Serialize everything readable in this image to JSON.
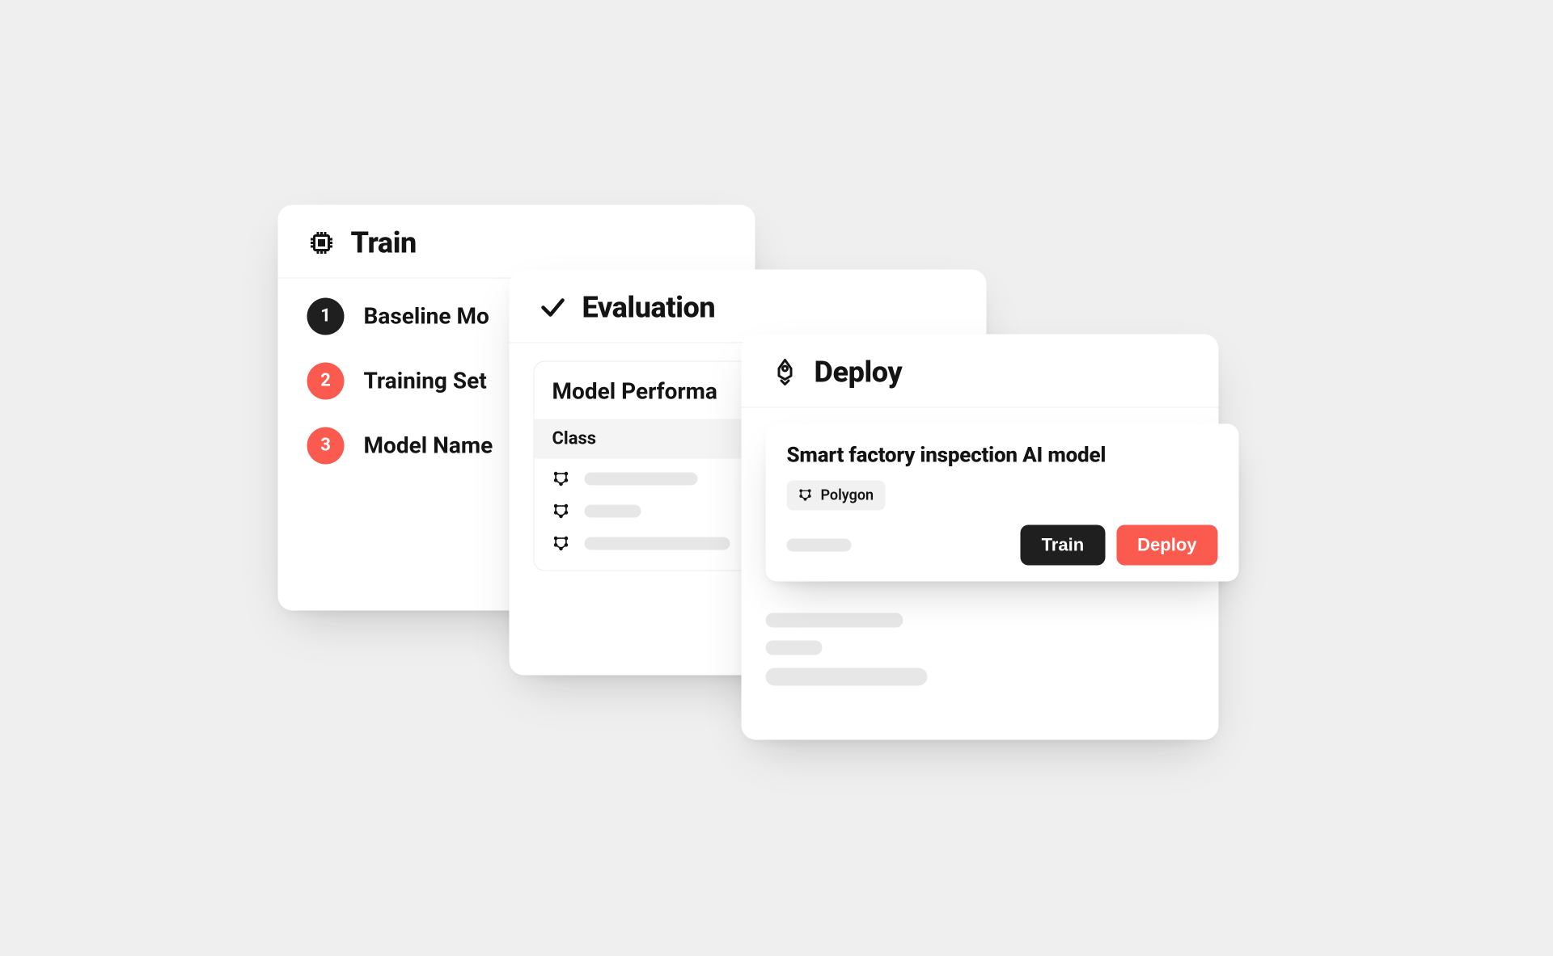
{
  "train": {
    "title": "Train",
    "steps": [
      {
        "num": "1",
        "label": "Baseline Mo",
        "variant": "dark"
      },
      {
        "num": "2",
        "label": "Training Set",
        "variant": "accent"
      },
      {
        "num": "3",
        "label": "Model Name",
        "variant": "accent"
      }
    ]
  },
  "evaluation": {
    "title": "Evaluation",
    "panel_title": "Model Performa",
    "column_header": "Class"
  },
  "deploy": {
    "title": "Deploy",
    "model": {
      "title": "Smart factory inspection AI model",
      "chip_label": "Polygon",
      "train_button": "Train",
      "deploy_button": "Deploy"
    }
  },
  "colors": {
    "accent": "#fb5a4e",
    "dark": "#1f1f1f"
  }
}
